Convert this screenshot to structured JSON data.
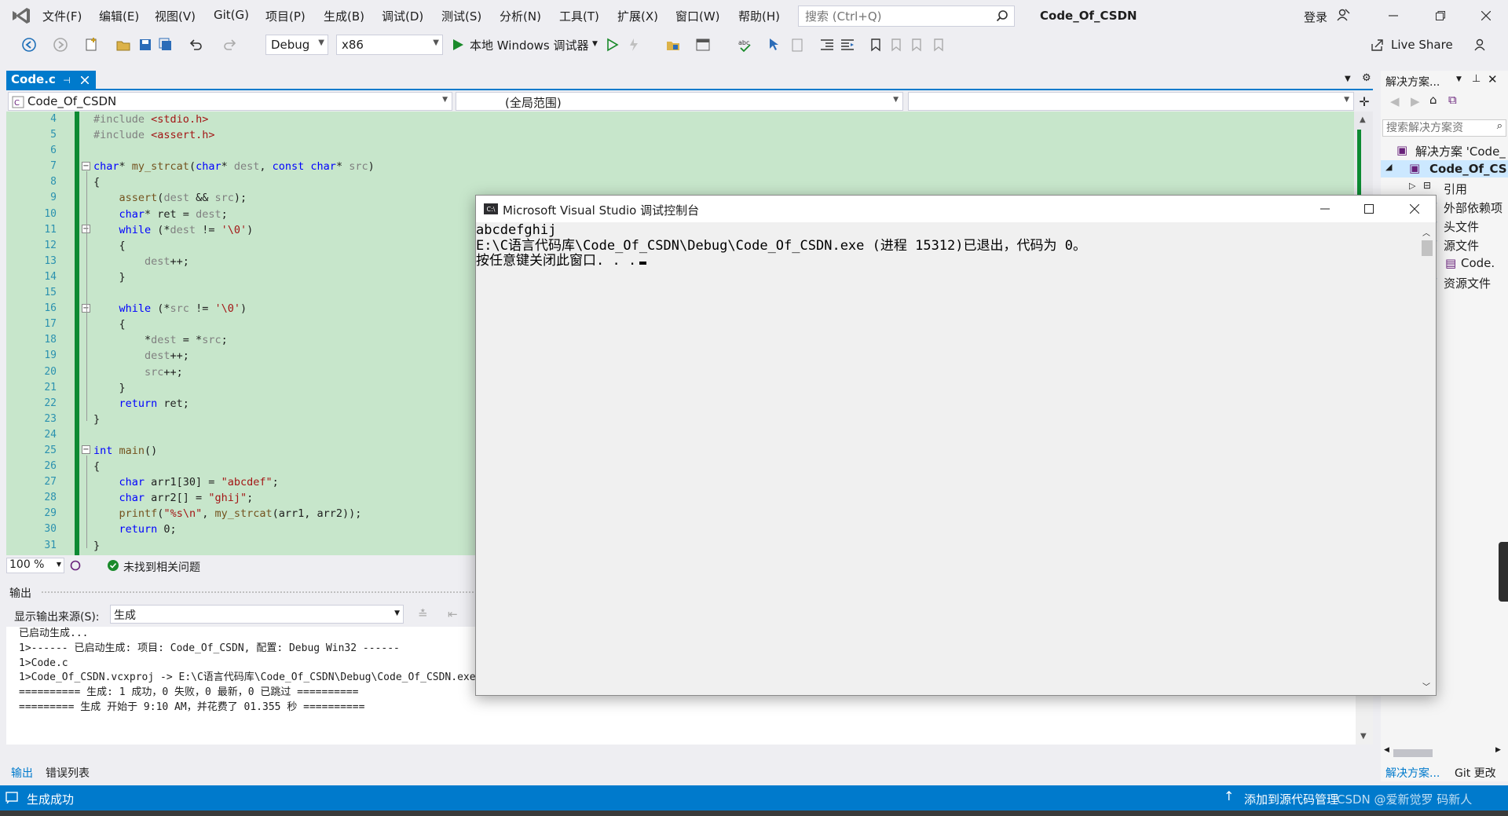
{
  "menubar": {
    "items": [
      "文件(F)",
      "编辑(E)",
      "视图(V)",
      "Git(G)",
      "项目(P)",
      "生成(B)",
      "调试(D)",
      "测试(S)",
      "分析(N)",
      "工具(T)",
      "扩展(X)",
      "窗口(W)",
      "帮助(H)"
    ],
    "search_placeholder": "搜索 (Ctrl+Q)",
    "solution_name": "Code_Of_CSDN",
    "login": "登录"
  },
  "toolbar": {
    "config": "Debug",
    "platform": "x86",
    "run_label": "本地 Windows 调试器",
    "live_share": "Live Share"
  },
  "editor": {
    "tab_name": "Code.c",
    "project_combo": "Code_Of_CSDN",
    "scope_combo": "(全局范围)",
    "member_combo": "",
    "line_numbers": [
      "4",
      "5",
      "6",
      "7",
      "8",
      "9",
      "10",
      "11",
      "12",
      "13",
      "14",
      "15",
      "16",
      "17",
      "18",
      "19",
      "20",
      "21",
      "22",
      "23",
      "24",
      "25",
      "26",
      "27",
      "28",
      "29",
      "30",
      "31"
    ],
    "zoom": "100 %",
    "issues": "未找到相关问题"
  },
  "output": {
    "title": "输出",
    "source_label": "显示输出来源(S):",
    "source_value": "生成",
    "lines": [
      "已启动生成...",
      "1>------ 已启动生成: 项目: Code_Of_CSDN, 配置: Debug Win32 ------",
      "1>Code.c",
      "1>Code_Of_CSDN.vcxproj -> E:\\C语言代码库\\Code_Of_CSDN\\Debug\\Code_Of_CSDN.exe",
      "========== 生成: 1 成功，0 失败，0 最新，0 已跳过 ==========",
      "========= 生成 开始于 9:10 AM，并花费了 01.355 秒 =========="
    ],
    "tab_output": "输出",
    "tab_errors": "错误列表"
  },
  "solution_explorer": {
    "title": "解决方案...",
    "search_placeholder": "搜索解决方案资",
    "solution_node": "解决方案 'Code_",
    "project_node": "Code_Of_CS",
    "items": [
      "引用",
      "外部依赖项",
      "头文件",
      "源文件",
      "Code.",
      "资源文件"
    ],
    "tab_solution": "解决方案...",
    "tab_git": "Git 更改"
  },
  "console": {
    "title": "Microsoft Visual Studio 调试控制台",
    "lines": [
      "abcdefghij",
      "",
      "E:\\C语言代码库\\Code_Of_CSDN\\Debug\\Code_Of_CSDN.exe (进程 15312)已退出，代码为 0。",
      "按任意键关闭此窗口. . ."
    ]
  },
  "statusbar": {
    "left": "生成成功",
    "right": "添加到源代码管理",
    "watermark": "CSDN @爱新觉罗 码新人"
  },
  "colors": {
    "accent": "#007acc",
    "editor_bg": "#c7e6cb",
    "change_bar": "#0d8a33"
  }
}
